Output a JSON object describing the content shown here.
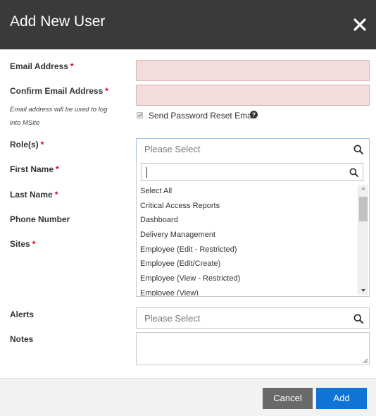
{
  "header": {
    "title": "Add New User",
    "close_icon": "close-icon"
  },
  "form": {
    "required_marker": "*",
    "email": {
      "label": "Email Address",
      "value": ""
    },
    "confirm_email": {
      "label": "Confirm Email Address",
      "value": ""
    },
    "hint_line1": "Email address will be used to log",
    "hint_line2": "into MSite",
    "send_reset": {
      "label": "Send Password Reset Email",
      "checked": true
    },
    "roles": {
      "label": "Role(s)",
      "placeholder": "Please Select",
      "search_value": "",
      "options": [
        "Select All",
        "Critical Access Reports",
        "Dashboard",
        "Delivery Management",
        "Employee (Edit - Restricted)",
        "Employee (Edit/Create)",
        "Employee (View - Restricted)",
        "Employee (View)"
      ]
    },
    "first_name": {
      "label": "First Name"
    },
    "last_name": {
      "label": "Last Name"
    },
    "phone": {
      "label": "Phone Number"
    },
    "sites": {
      "label": "Sites"
    },
    "alerts": {
      "label": "Alerts",
      "placeholder": "Please Select"
    },
    "notes": {
      "label": "Notes",
      "value": ""
    }
  },
  "footer": {
    "cancel_label": "Cancel",
    "add_label": "Add"
  },
  "colors": {
    "header_bg": "#3a3a3a",
    "invalid_field_bg": "#f4dcdc",
    "required": "#d0021b",
    "primary": "#1074d6",
    "secondary": "#6a6a6a"
  }
}
